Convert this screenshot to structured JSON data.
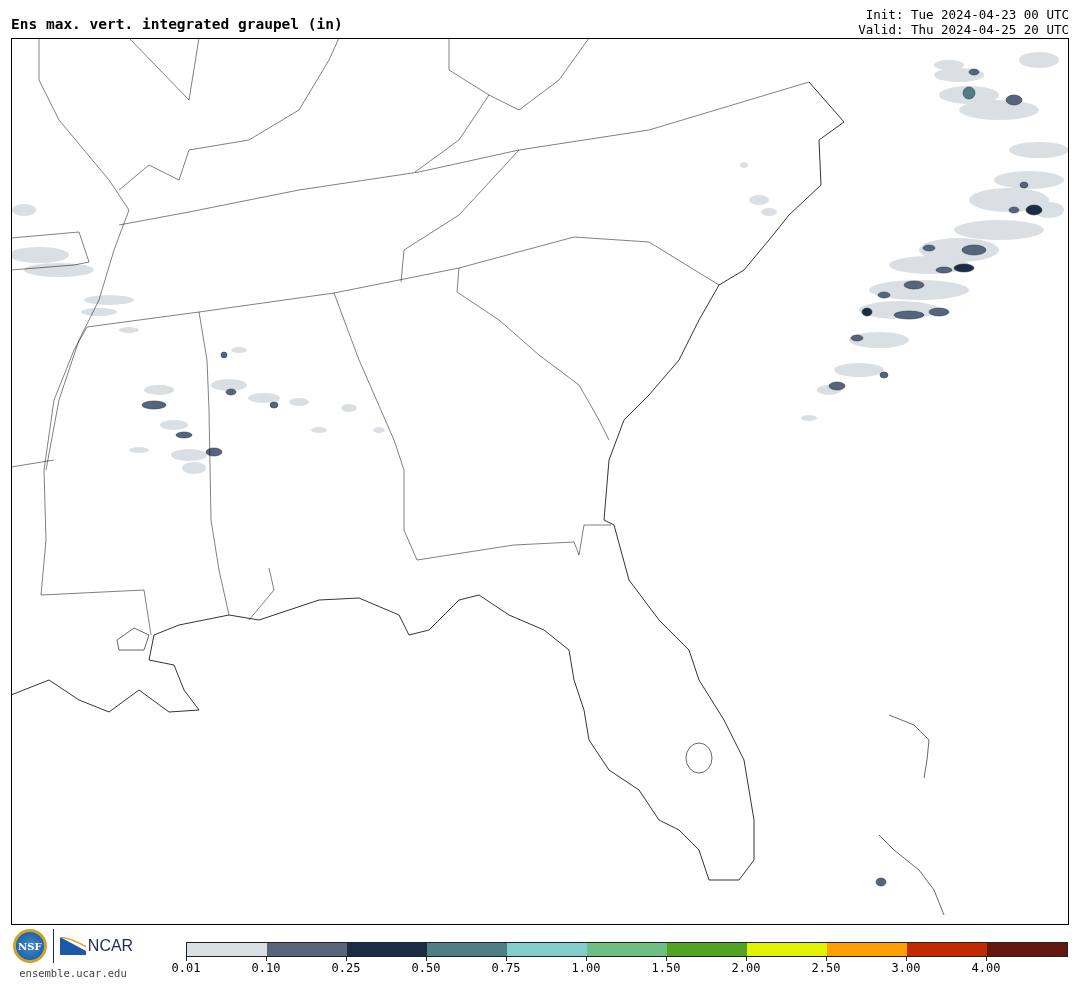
{
  "header": {
    "title": "Ens max. vert. integrated graupel (in)",
    "init": "Init: Tue 2024-04-23 00 UTC",
    "valid": "Valid: Thu 2024-04-25 20 UTC"
  },
  "footer": {
    "nsf_logo_text": "NSF",
    "ncar_logo_text": "NCAR",
    "url": "ensemble.ucar.edu"
  },
  "legend": {
    "bins": [
      {
        "color": "#dadfe3",
        "label": "0.01"
      },
      {
        "color": "#56657a",
        "label": "0.10"
      },
      {
        "color": "#1b2c45",
        "label": "0.25"
      },
      {
        "color": "#4f7f84",
        "label": "0.50"
      },
      {
        "color": "#84cdca",
        "label": "0.75"
      },
      {
        "color": "#6dbf84",
        "label": "1.00"
      },
      {
        "color": "#52a324",
        "label": "1.50"
      },
      {
        "color": "#e3f200",
        "label": "2.00"
      },
      {
        "color": "#ffa000",
        "label": "2.50"
      },
      {
        "color": "#c42a00",
        "label": "3.00"
      },
      {
        "color": "#64170c",
        "label": "4.00"
      }
    ]
  }
}
